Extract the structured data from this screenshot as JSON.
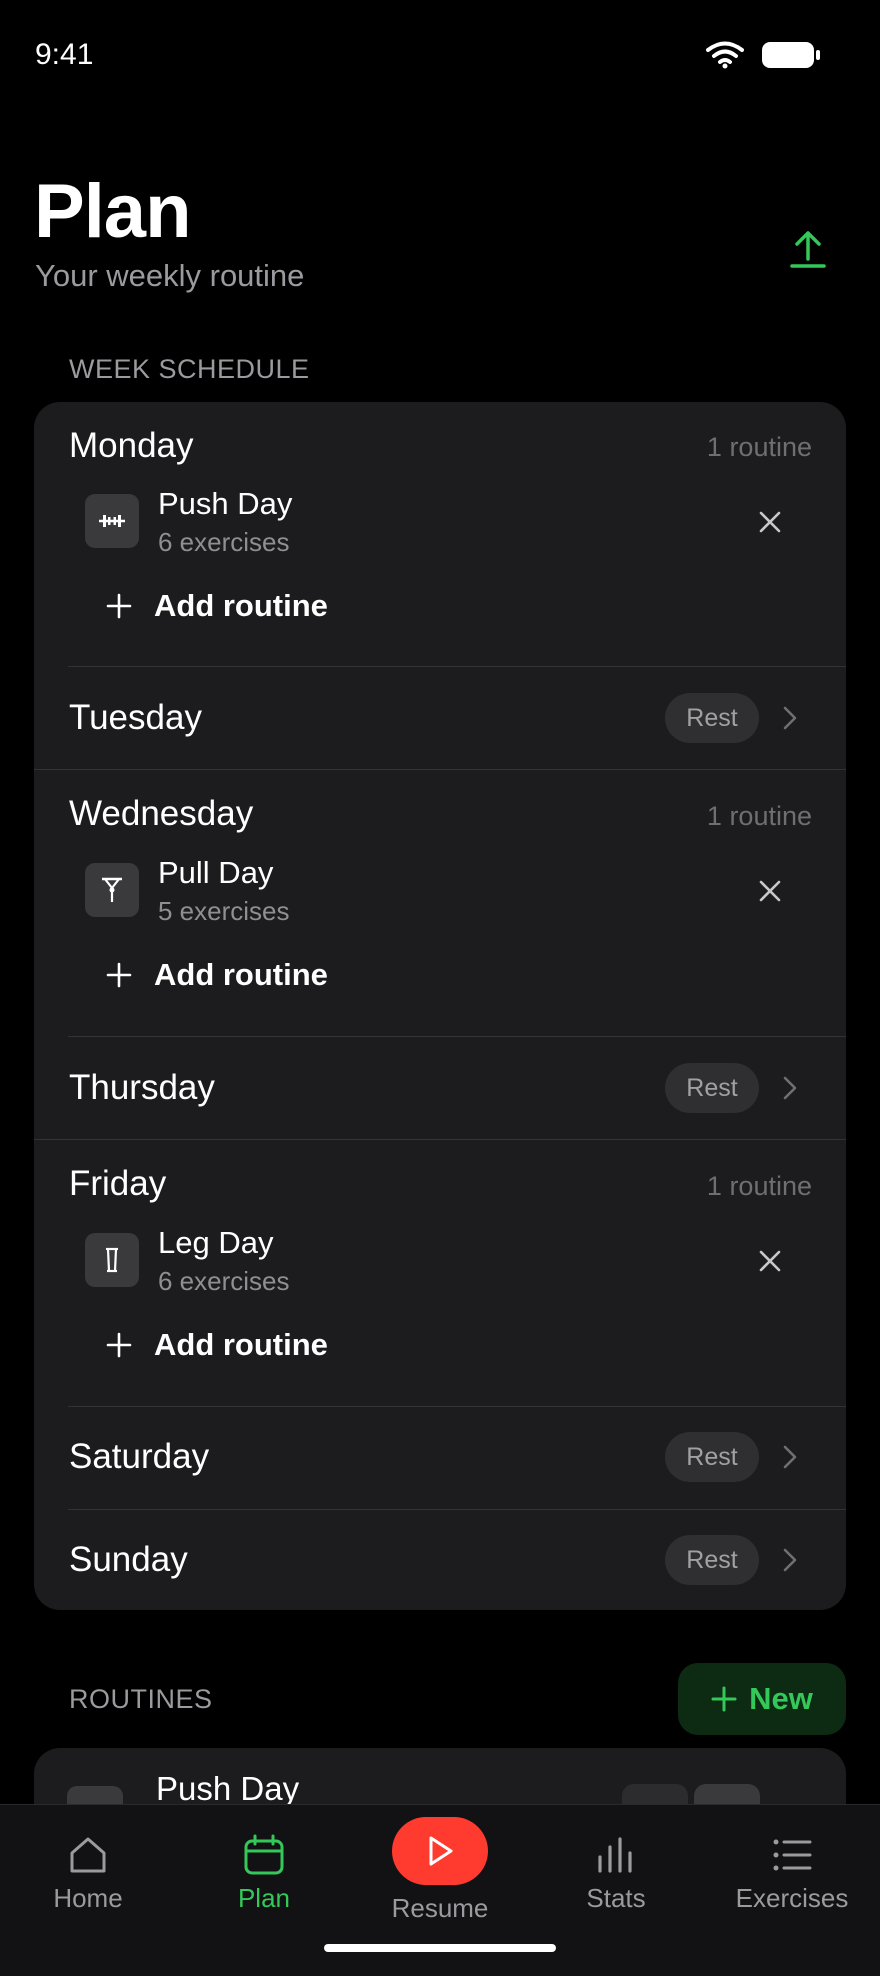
{
  "status": {
    "time": "9:41"
  },
  "header": {
    "title": "Plan",
    "subtitle": "Your weekly routine"
  },
  "week": {
    "section_label": "WEEK SCHEDULE",
    "add_routine_label": "Add routine",
    "days": [
      {
        "name": "Monday",
        "meta": "1 routine",
        "routine": {
          "name": "Push Day",
          "sub": "6 exercises",
          "icon": "dumbbell-icon"
        }
      },
      {
        "name": "Tuesday",
        "rest": "Rest"
      },
      {
        "name": "Wednesday",
        "meta": "1 routine",
        "routine": {
          "name": "Pull Day",
          "sub": "5 exercises",
          "icon": "pullup-icon"
        }
      },
      {
        "name": "Thursday",
        "rest": "Rest"
      },
      {
        "name": "Friday",
        "meta": "1 routine",
        "routine": {
          "name": "Leg Day",
          "sub": "6 exercises",
          "icon": "leg-icon"
        }
      },
      {
        "name": "Saturday",
        "rest": "Rest"
      },
      {
        "name": "Sunday",
        "rest": "Rest"
      }
    ]
  },
  "routines": {
    "section_label": "ROUTINES",
    "new_label": "New",
    "preview_name": "Push Day"
  },
  "tabbar": {
    "tabs": [
      {
        "label": "Home",
        "icon": "home-icon"
      },
      {
        "label": "Plan",
        "icon": "calendar-icon",
        "active": true
      },
      {
        "label": "Resume",
        "icon": "play-icon"
      },
      {
        "label": "Stats",
        "icon": "bar-chart-icon"
      },
      {
        "label": "Exercises",
        "icon": "list-icon"
      }
    ]
  },
  "colors": {
    "accent": "#34c759",
    "resume": "#ff3b30",
    "card": "#1c1c1e",
    "background": "#000000"
  }
}
